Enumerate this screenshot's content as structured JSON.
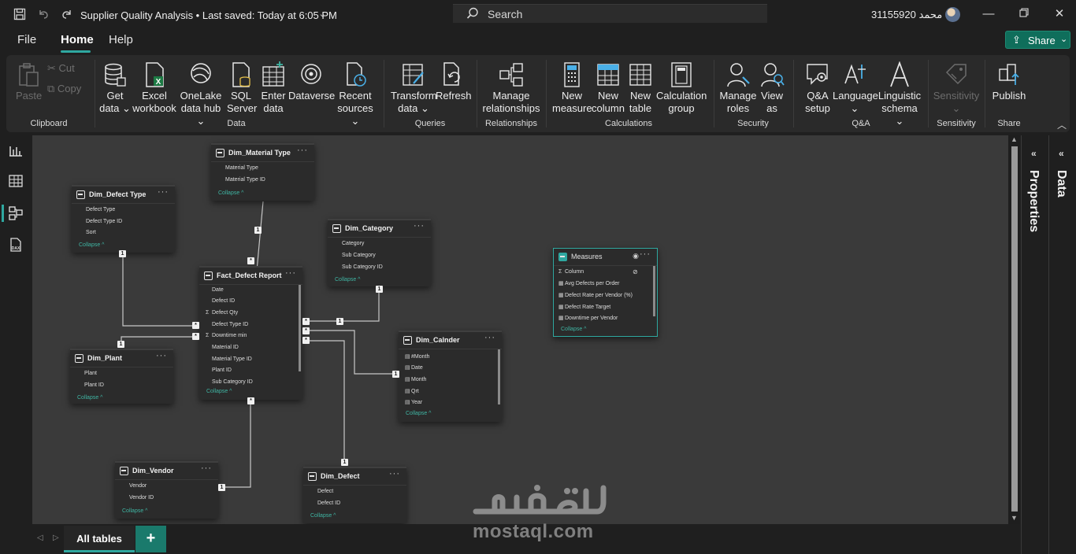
{
  "titlebar": {
    "doc_title": "Supplier Quality Analysis  •  Last saved: Today at 6:05 PM",
    "search_placeholder": "Search",
    "user_name": "31155920 محمد"
  },
  "menu": {
    "file": "File",
    "home": "Home",
    "help": "Help",
    "share": "Share"
  },
  "ribbon": {
    "clipboard": {
      "paste": "Paste",
      "cut": "Cut",
      "copy": "Copy",
      "label": "Clipboard"
    },
    "data": {
      "get_data_1": "Get",
      "get_data_2": "data ⌄",
      "excel_1": "Excel",
      "excel_2": "workbook",
      "onelake_1": "OneLake",
      "onelake_2": "data hub ⌄",
      "sql_1": "SQL",
      "sql_2": "Server",
      "enter_1": "Enter",
      "enter_2": "data",
      "dataverse": "Dataverse",
      "recent_1": "Recent",
      "recent_2": "sources ⌄",
      "label": "Data"
    },
    "queries": {
      "transform_1": "Transform",
      "transform_2": "data ⌄",
      "refresh": "Refresh",
      "label": "Queries"
    },
    "relationships": {
      "manage_1": "Manage",
      "manage_2": "relationships",
      "label": "Relationships"
    },
    "calculations": {
      "measure_1": "New",
      "measure_2": "measure",
      "column_1": "New",
      "column_2": "column",
      "table_1": "New",
      "table_2": "table",
      "calc_1": "Calculation",
      "calc_2": "group",
      "label": "Calculations"
    },
    "security": {
      "roles_1": "Manage",
      "roles_2": "roles",
      "view_1": "View",
      "view_2": "as",
      "label": "Security"
    },
    "qa": {
      "setup_1": "Q&A",
      "setup_2": "setup",
      "language": "Language",
      "language_2": "⌄",
      "schema_1": "Linguistic",
      "schema_2": "schema ⌄",
      "label": "Q&A"
    },
    "sensitivity": {
      "btn": "Sensitivity",
      "btn_2": "⌄",
      "label": "Sensitivity"
    },
    "share": {
      "publish": "Publish",
      "label": "Share"
    }
  },
  "tables": {
    "material_type": {
      "name": "Dim_Material Type",
      "fields": [
        "Material Type",
        "Material Type ID"
      ],
      "collapse": "Collapse ^"
    },
    "defect_type": {
      "name": "Dim_Defect Type",
      "fields": [
        "Defect Type",
        "Defect Type ID",
        "Sort"
      ],
      "collapse": "Collapse ^"
    },
    "category": {
      "name": "Dim_Category",
      "fields": [
        "Category",
        "Sub Category",
        "Sub Category ID"
      ],
      "collapse": "Collapse ^"
    },
    "fact": {
      "name": "Fact_Defect Report",
      "fields": [
        "Date",
        "Defect ID",
        "Defect Qty",
        "Defect Type ID",
        "Downtime min",
        "Material ID",
        "Material Type ID",
        "Plant ID",
        "Sub Category ID"
      ],
      "collapse": "Collapse ^"
    },
    "plant": {
      "name": "Dim_Plant",
      "fields": [
        "Plant",
        "Plant ID"
      ],
      "collapse": "Collapse ^"
    },
    "calendar": {
      "name": "Dim_Calnder",
      "fields": [
        "#Month",
        "Date",
        "Month",
        "Qrt",
        "Year"
      ],
      "collapse": "Collapse ^"
    },
    "measures": {
      "name": "Measures",
      "fields": [
        "Column",
        "Avg Defects per Order",
        "Defect Rate per Vendor (%)",
        "Defect Rate Target",
        "Downtime per Vendor"
      ],
      "collapse": "Collapse ^"
    },
    "vendor": {
      "name": "Dim_Vendor",
      "fields": [
        "Vendor",
        "Vendor ID"
      ],
      "collapse": "Collapse ^"
    },
    "defect": {
      "name": "Dim_Defect",
      "fields": [
        "Defect",
        "Defect ID"
      ],
      "collapse": "Collapse ^"
    }
  },
  "cardinality": {
    "one": "1",
    "many": "*"
  },
  "tabs": {
    "all_tables": "All tables",
    "add": "+"
  },
  "panes": {
    "properties": "Properties",
    "data": "Data"
  },
  "watermark": {
    "latin": "mostaql.com"
  },
  "colors": {
    "accent": "#2fa8a0",
    "share_bg": "#0f6e5b",
    "canvas": "#3a3a3a",
    "card": "#2b2b2b"
  }
}
